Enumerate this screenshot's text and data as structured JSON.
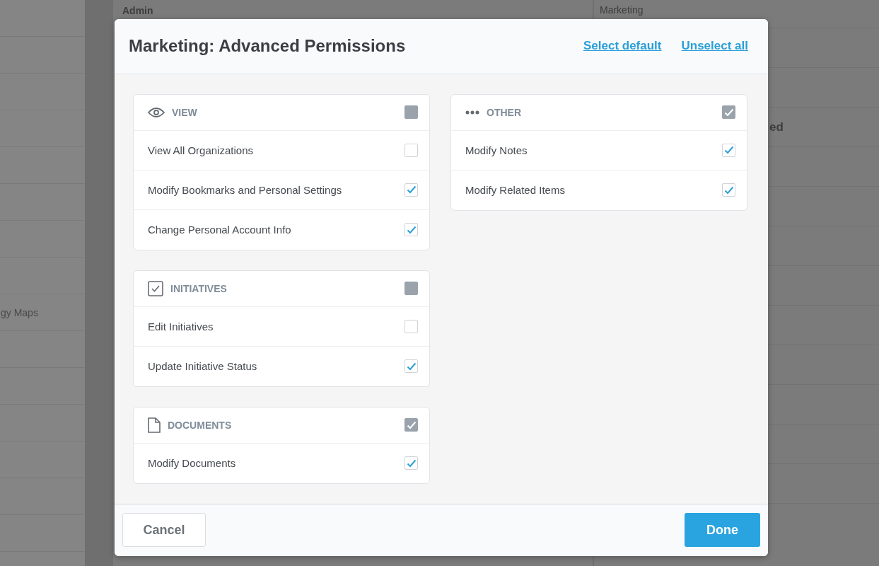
{
  "background": {
    "sidebar_items": [
      {
        "label": "gy Maps"
      }
    ],
    "header": "Admin",
    "side_panel": {
      "title": "Marketing",
      "row_text": "ed"
    }
  },
  "dialog": {
    "title": "Marketing: Advanced Permissions",
    "header_links": [
      "Select default",
      "Unselect all"
    ],
    "columns": [
      {
        "groups": [
          {
            "kind": "view",
            "title": "VIEW",
            "checked": false,
            "items": [
              {
                "label": "View All Organizations",
                "checked": false
              },
              {
                "label": "Modify Bookmarks and Personal Settings",
                "checked": true
              },
              {
                "label": "Change Personal Account Info",
                "checked": true
              }
            ]
          },
          {
            "kind": "initiatives",
            "title": "INITIATIVES",
            "checked": false,
            "items": [
              {
                "label": "Edit Initiatives",
                "checked": false
              },
              {
                "label": "Update Initiative Status",
                "checked": true
              }
            ]
          },
          {
            "kind": "documents",
            "title": "DOCUMENTS",
            "checked": true,
            "items": [
              {
                "label": "Modify Documents",
                "checked": true
              }
            ]
          }
        ]
      },
      {
        "groups": [
          {
            "kind": "other",
            "title": "OTHER",
            "checked": true,
            "items": [
              {
                "label": "Modify Notes",
                "checked": true
              },
              {
                "label": "Modify Related Items",
                "checked": true
              }
            ]
          }
        ]
      }
    ],
    "cancel_button": "Cancel",
    "done_button": "Done"
  }
}
